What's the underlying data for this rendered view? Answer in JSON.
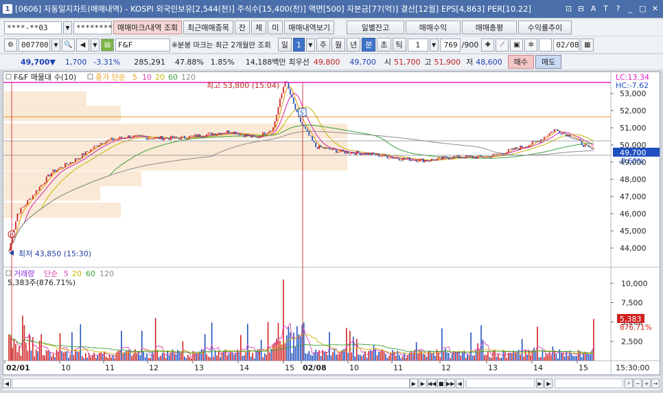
{
  "window": {
    "title": "[0606] 자동일지차트(매매내역) - KOSPI 외국인보유[2,544(천)] 주식수[15,400(천)] 액면[500] 자본금[77(억)] 결산[12월] EPS[4,863] PER[10.22]",
    "icon_label": "1",
    "buttons": [
      "⊡",
      "⊟",
      "A",
      "T",
      "?",
      "_",
      "□",
      "✕"
    ]
  },
  "toolbar1": {
    "account": "****-**03",
    "password": "********",
    "buttons": [
      "매매마크/내역 조회",
      "최근매매종목",
      "잔",
      "체",
      "미",
      "매매내역보기"
    ],
    "right_buttons": [
      "일별잔고",
      "매매수익",
      "매매총평",
      "수익률추이"
    ]
  },
  "toolbar2": {
    "code": "007700",
    "stock_name": "F&F",
    "note": "※분봉 마크는 최근 2개월만 조회",
    "period_buttons": [
      "일",
      "1",
      "주",
      "월",
      "년",
      "분",
      "초",
      "틱"
    ],
    "selected_period": "분",
    "interval": "1",
    "count": "769",
    "count_total": "/900",
    "date": "02/08"
  },
  "quote": {
    "price": "49,700▼",
    "change": "1,700",
    "change_pct": "-3.31%",
    "volume": "285,291",
    "turnover": "47.88%",
    "ratio": "1.85%",
    "amount": "14,188백만",
    "best_bid_label": "최우선",
    "best_bid": "49,800",
    "best_ask": "49,700",
    "open_label": "시",
    "open": "51,700",
    "high_label": "고",
    "high": "51,900",
    "low_label": "저",
    "low": "48,600",
    "buy_button": "매수",
    "sell_button": "매도"
  },
  "chart": {
    "price_legend": "F&F 매물대 수(10)",
    "ma_legend_label": "종가 단순",
    "ma_periods": [
      "5",
      "10",
      "20",
      "60",
      "120"
    ],
    "ma_colors": [
      "#e8a019",
      "#d63fb0",
      "#c8b400",
      "#3aa03a",
      "#8c8c8c"
    ],
    "lc_label": "LC:13.34",
    "hc_label": "HC:-7.62",
    "max_label": "최고 53,800 (15:04)",
    "min_label": "최저 43,850 (15:30)",
    "current_price_tag": "49,700",
    "current_pct_tag": "-0.60%",
    "price_ticks": [
      "53,000",
      "52,000",
      "51,000",
      "50,000",
      "49,000",
      "48,000",
      "47,000",
      "46,000",
      "45,000",
      "44,000"
    ],
    "volume_legend_label": "거래량",
    "volume_ma_label": "단순",
    "volume_ma_periods": [
      "5",
      "20",
      "60",
      "120"
    ],
    "volume_now": "5,383주(876.71%)",
    "volume_ticks": [
      "10,000",
      "7,500",
      "5,000",
      "2,500"
    ],
    "volume_tag": "5,383",
    "volume_pct_tag": "876.71%",
    "time_labels": [
      "02/01",
      "10",
      "11",
      "12",
      "13",
      "14",
      "15",
      "02/08",
      "10",
      "11",
      "12",
      "13",
      "14",
      "15"
    ],
    "time_tag": "15:30:00",
    "buy_marker": "B",
    "sell_marker": "S"
  },
  "chart_data": {
    "type": "line",
    "title": "F&F 매물대 수(10)",
    "ylim": [
      43500,
      53900
    ],
    "close_keypoints": [
      [
        0,
        43850
      ],
      [
        5,
        46000
      ],
      [
        15,
        47200
      ],
      [
        25,
        48400
      ],
      [
        40,
        49200
      ],
      [
        55,
        50200
      ],
      [
        70,
        50500
      ],
      [
        85,
        50400
      ],
      [
        100,
        50400
      ],
      [
        115,
        50600
      ],
      [
        130,
        50800
      ],
      [
        145,
        50400
      ],
      [
        155,
        51000
      ],
      [
        162,
        53800
      ],
      [
        170,
        51500
      ],
      [
        180,
        49900
      ],
      [
        195,
        49600
      ],
      [
        210,
        49500
      ],
      [
        230,
        49200
      ],
      [
        245,
        49100
      ],
      [
        260,
        49300
      ],
      [
        280,
        49300
      ],
      [
        295,
        49700
      ],
      [
        310,
        50200
      ],
      [
        320,
        50900
      ],
      [
        330,
        50500
      ],
      [
        340,
        49800
      ],
      [
        343,
        49700
      ]
    ],
    "volume_ylim": [
      0,
      11000
    ]
  }
}
